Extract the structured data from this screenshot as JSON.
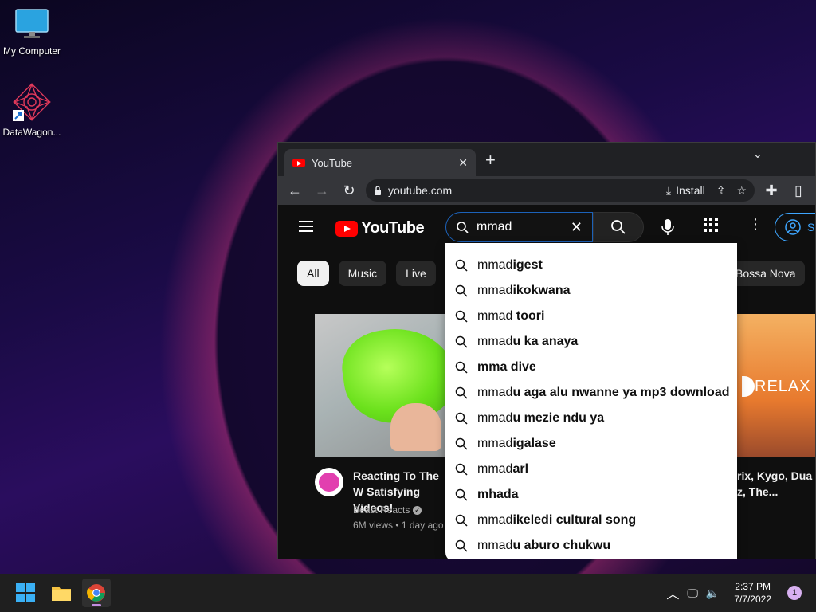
{
  "desktop": {
    "icons": [
      {
        "label": "My Computer"
      },
      {
        "label": "DataWagon..."
      }
    ]
  },
  "browser": {
    "tab_title": "YouTube",
    "url": "youtube.com",
    "install_label": "Install"
  },
  "youtube": {
    "logo_text": "YouTube",
    "search_value": "mmad",
    "signin_label": "S",
    "chips": [
      "All",
      "Music",
      "Live",
      "Bossa Nova"
    ],
    "suggestions": [
      {
        "typed": "mmad",
        "rest": "igest"
      },
      {
        "typed": "mmad",
        "rest": "ikokwana"
      },
      {
        "typed": "mmad",
        "rest": " toori"
      },
      {
        "typed": "mmad",
        "rest": "u ka anaya"
      },
      {
        "typed": "",
        "rest": "mma dive"
      },
      {
        "typed": "mmad",
        "rest": "u aga alu nwanne ya mp3 download"
      },
      {
        "typed": "mmad",
        "rest": "u mezie ndu ya"
      },
      {
        "typed": "mmad",
        "rest": "igalase"
      },
      {
        "typed": "mmad",
        "rest": "arl"
      },
      {
        "typed": "",
        "rest": "mhada"
      },
      {
        "typed": "mmad",
        "rest": "ikeledi cultural song"
      },
      {
        "typed": "mmad",
        "rest": "u aburo chukwu"
      }
    ],
    "video1": {
      "title": "Reacting To The W Satisfying Videos!",
      "channel": "Beast Reacts",
      "meta": "6M views • 1 day ago"
    },
    "video2": {
      "thumb_text": "RELAX",
      "title": "rix, Kygo, Dua\nz, The..."
    }
  },
  "taskbar": {
    "time": "2:37 PM",
    "date": "7/7/2022",
    "notification_count": "1"
  }
}
